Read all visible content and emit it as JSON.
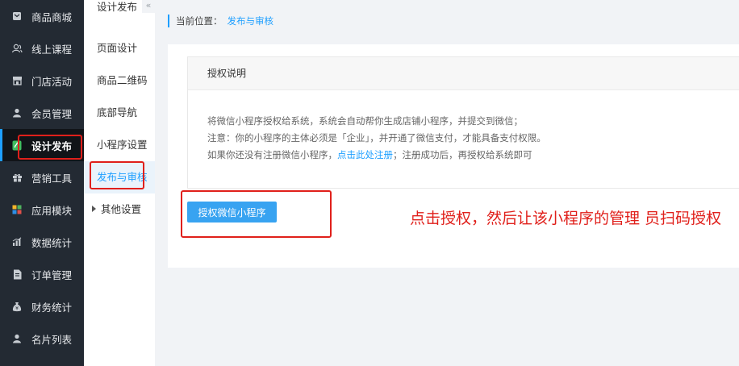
{
  "nav": {
    "items": [
      {
        "label": "商品商城",
        "icon": "shop-icon"
      },
      {
        "label": "线上课程",
        "icon": "users-icon"
      },
      {
        "label": "门店活动",
        "icon": "store-icon"
      },
      {
        "label": "会员管理",
        "icon": "user-icon"
      },
      {
        "label": "设计发布",
        "icon": "mini-program-icon",
        "active": true
      },
      {
        "label": "营销工具",
        "icon": "gift-icon"
      },
      {
        "label": "应用模块",
        "icon": "apps-icon"
      },
      {
        "label": "数据统计",
        "icon": "bar-chart-icon"
      },
      {
        "label": "订单管理",
        "icon": "document-icon"
      },
      {
        "label": "财务统计",
        "icon": "money-bag-icon"
      },
      {
        "label": "名片列表",
        "icon": "contact-icon"
      }
    ]
  },
  "subnav": {
    "title": "设计发布",
    "collapse_glyph": "«",
    "items": [
      "页面设计",
      "商品二维码",
      "底部导航",
      "小程序设置",
      "发布与审核"
    ],
    "group": "其他设置"
  },
  "breadcrumb": {
    "prefix": "当前位置：",
    "current": "发布与审核"
  },
  "card": {
    "title": "授权说明",
    "line1": "将微信小程序授权给系统，系统会自动帮你生成店铺小程序，并提交到微信；",
    "line2": "注意：你的小程序的主体必须是「企业」，并开通了微信支付，才能具备支付权限。",
    "line3_pre": "如果你还没有注册微信小程序，",
    "line3_link": "点击此处注册",
    "line3_post": "；注册成功后，再授权给系统即可"
  },
  "auth_button": "授权微信小程序",
  "annotation": "点击授权，然后让该小程序的管理 员扫码授权",
  "colors": {
    "accent": "#1e9fff",
    "annotation_red": "#e0201b",
    "nav_bg": "#232a33"
  }
}
